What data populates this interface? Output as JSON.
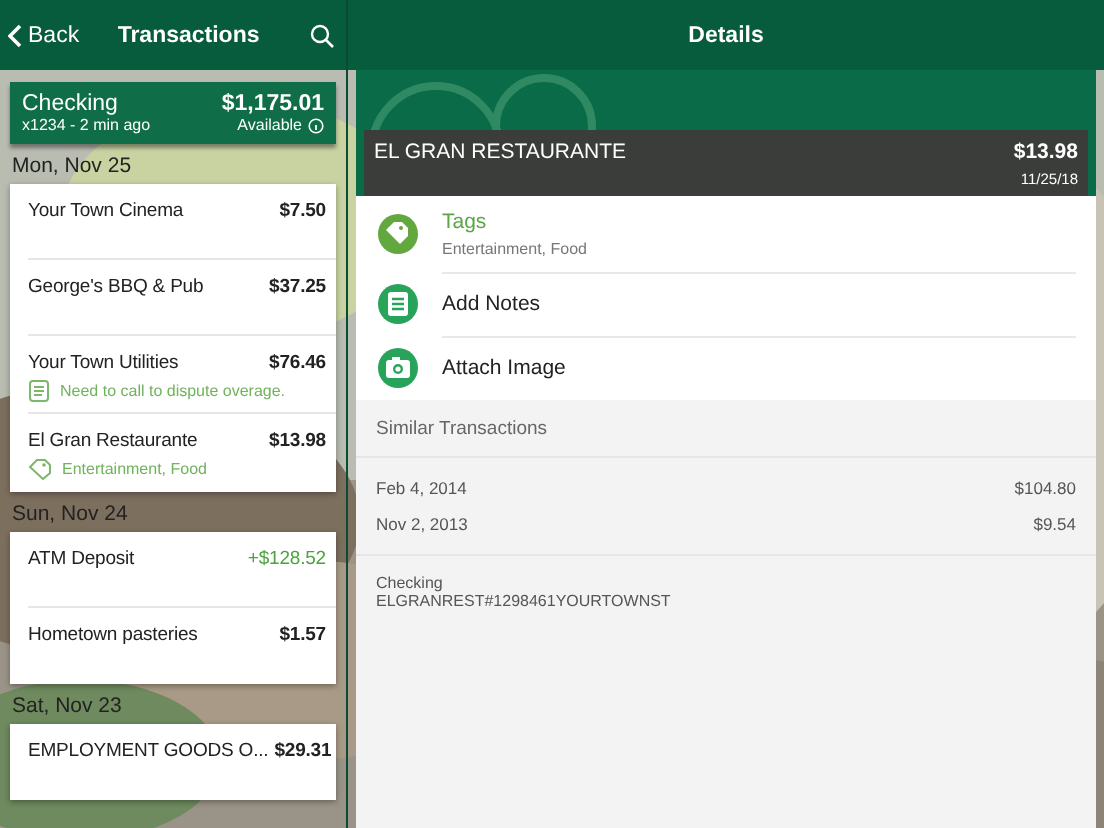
{
  "left_bar": {
    "back": "Back",
    "title": "Transactions"
  },
  "account": {
    "name": "Checking",
    "balance": "$1,175.01",
    "meta": "x1234 - 2 min ago",
    "available": "Available"
  },
  "groups": [
    {
      "date": "Mon, Nov 25",
      "rows": [
        {
          "name": "Your Town Cinema",
          "amount": "$7.50",
          "kind": "debit"
        },
        {
          "name": "George's BBQ & Pub",
          "amount": "$37.25",
          "kind": "debit"
        },
        {
          "name": "Your Town Utilities",
          "amount": "$76.46",
          "kind": "debit",
          "note": {
            "kind": "memo",
            "text": "Need to call to dispute overage."
          }
        },
        {
          "name": "El Gran Restaurante",
          "amount": "$13.98",
          "kind": "debit",
          "note": {
            "kind": "tags",
            "text": "Entertainment, Food"
          }
        }
      ]
    },
    {
      "date": "Sun, Nov 24",
      "rows": [
        {
          "name": "ATM Deposit",
          "amount": "+$128.52",
          "kind": "credit"
        },
        {
          "name": "Hometown pasteries",
          "amount": "$1.57",
          "kind": "debit"
        }
      ]
    },
    {
      "date": "Sat, Nov 23",
      "rows": [
        {
          "name": "EMPLOYMENT GOODS O...",
          "amount": "$29.31",
          "kind": "debit"
        }
      ]
    }
  ],
  "detail": {
    "title": "Details",
    "merchant": "EL GRAN RESTAURANTE",
    "amount": "$13.98",
    "date": "11/25/18",
    "actions": [
      {
        "kind": "tags",
        "label": "Tags",
        "sub": "Entertainment, Food"
      },
      {
        "kind": "notes",
        "label": "Add Notes"
      },
      {
        "label": "Attach Image"
      }
    ],
    "similar_title": "Similar Transactions",
    "similar": [
      {
        "date": "Feb 4, 2014",
        "amount": "$104.80"
      },
      {
        "date": "Nov 2, 2013",
        "amount": "$9.54"
      }
    ],
    "account": "Checking",
    "description": "ELGRANREST#1298461YOURTOWNST"
  }
}
